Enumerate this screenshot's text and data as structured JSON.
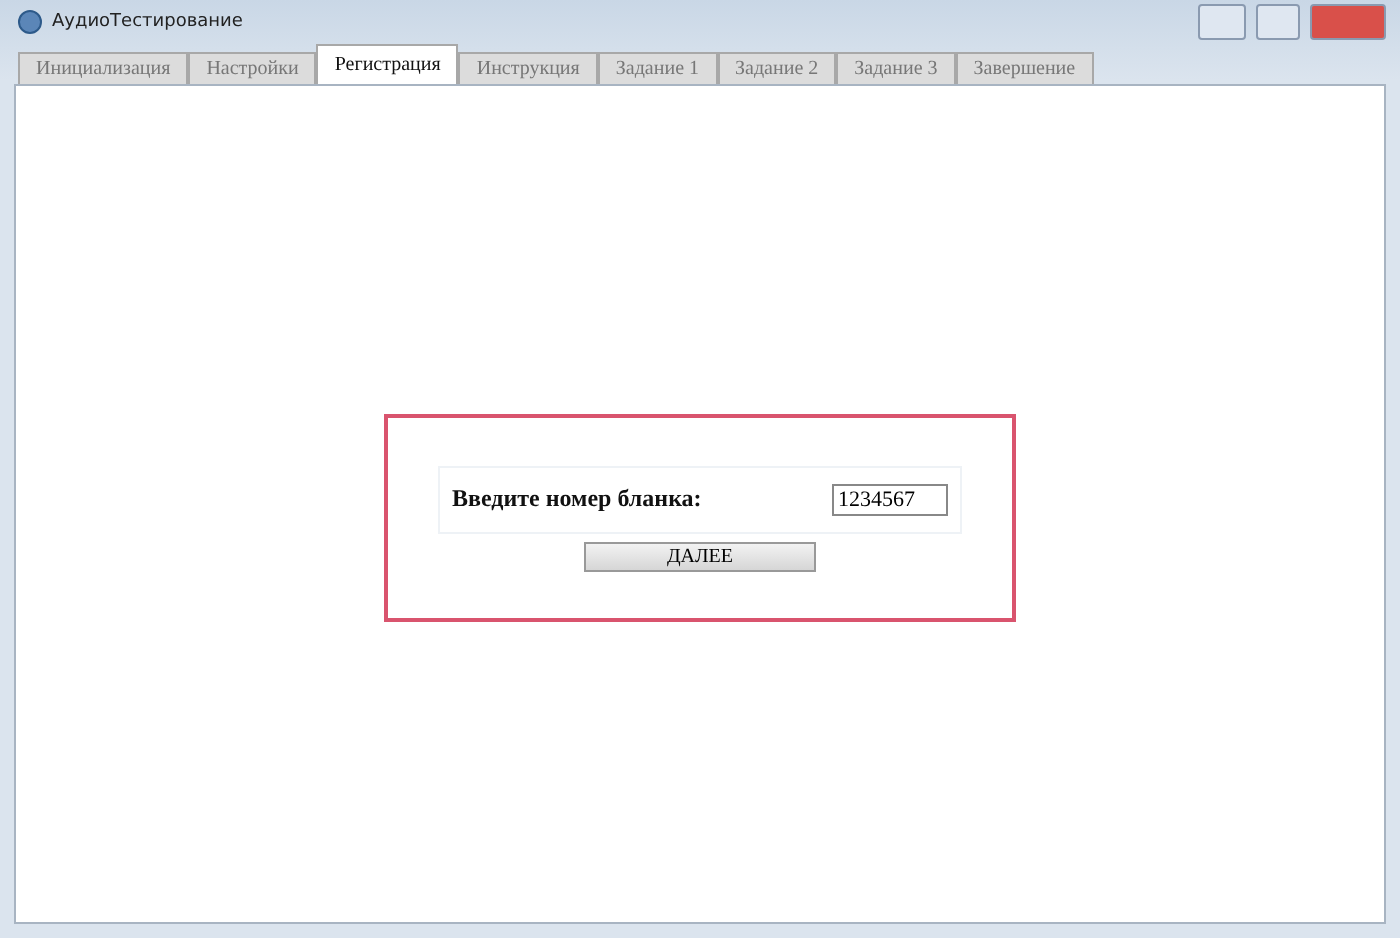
{
  "window": {
    "title": "АудиоТестирование"
  },
  "tabs": [
    {
      "label": "Инициализация",
      "selected": false
    },
    {
      "label": "Настройки",
      "selected": false
    },
    {
      "label": "Регистрация",
      "selected": true
    },
    {
      "label": "Инструкция",
      "selected": false
    },
    {
      "label": "Задание 1",
      "selected": false
    },
    {
      "label": "Задание 2",
      "selected": false
    },
    {
      "label": "Задание 3",
      "selected": false
    },
    {
      "label": "Завершение",
      "selected": false
    }
  ],
  "form": {
    "label": "Введите номер бланка:",
    "value": "1234567",
    "button": "ДАЛЕЕ"
  }
}
